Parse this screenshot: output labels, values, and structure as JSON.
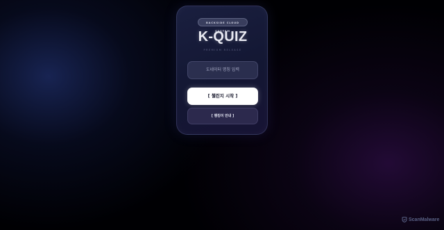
{
  "login_card": {
    "badge": "BACKSIDE CLOUD SYSTEM",
    "title": "K-QUIZ",
    "subtitle": "PREMIUM RELEASE",
    "nickname_input": {
      "placeholder": "도네이터 명칭 입력",
      "value": ""
    },
    "start_button": "[ 챌린지 시작 ]",
    "secondary_button": "[ 랭킹이 안내 ]"
  },
  "watermark": {
    "icon": "scanmalware-logo-icon",
    "label": "ScanMalware"
  },
  "colors": {
    "card_bg": "#161a39",
    "primary_button": "#ffffff",
    "text_light": "#e9eaf2"
  }
}
